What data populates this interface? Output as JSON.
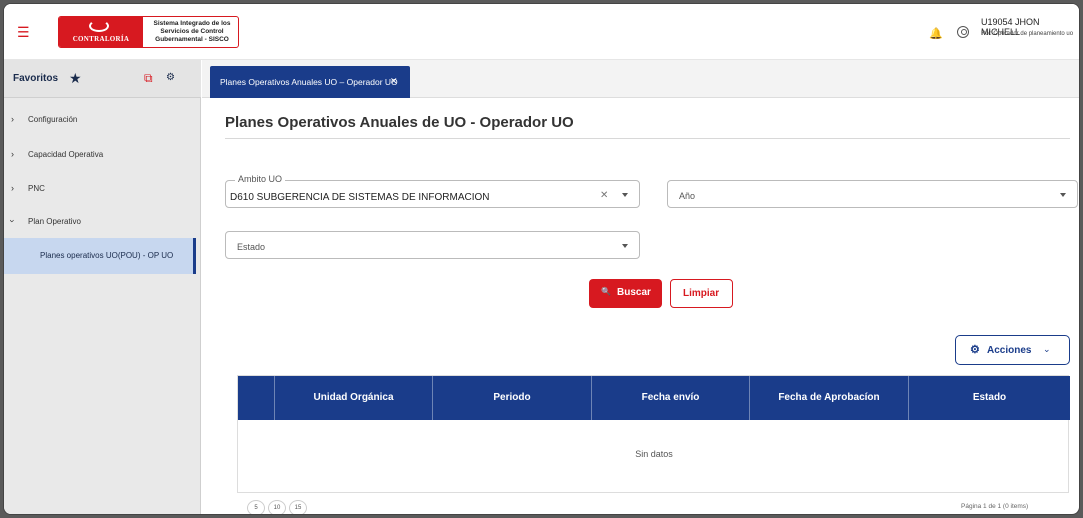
{
  "header": {
    "menu_icon": "hamburger-icon",
    "logo": {
      "name": "CONTRALORÍA",
      "text": "Sistema Integrado de los Servicios de Control Gubernamental - SISCO"
    },
    "user": {
      "name": "U19054 JHON MICHELL",
      "role": "Rol: Operador de planeamiento uo"
    },
    "bell_icon": "bell-icon",
    "user_icon": "user-circle-icon"
  },
  "sidebar": {
    "favorites_label": "Favoritos",
    "favorites_icon": "star-icon",
    "items": [
      {
        "label": "Configuración",
        "expanded": false
      },
      {
        "label": "Capacidad Operativa",
        "expanded": false
      },
      {
        "label": "PNC",
        "expanded": false
      },
      {
        "label": "Plan Operativo",
        "expanded": true
      }
    ],
    "active_item": "Planes operativos UO(POU) - OP UO"
  },
  "tabs": [
    {
      "label": "Planes Operativos Anuales UO – Operador UO",
      "active": true
    }
  ],
  "main": {
    "title": "Planes Operativos Anuales de UO - Operador UO",
    "filters": {
      "ambito": {
        "label": "Ambito UO",
        "value": "D610 SUBGERENCIA DE SISTEMAS DE INFORMACION"
      },
      "anio": {
        "placeholder": "Año"
      },
      "estado": {
        "placeholder": "Estado"
      }
    },
    "buttons": {
      "buscar": "Buscar",
      "limpiar": "Limpiar",
      "acciones": "Acciones"
    }
  },
  "table": {
    "columns": [
      "Unidad Orgánica",
      "Periodo",
      "Fecha envío",
      "Fecha de Aprobacíon",
      "Estado"
    ],
    "rows": [],
    "empty_text": "Sin datos",
    "page_sizes": [
      "5",
      "10",
      "15"
    ],
    "pagination_info": "Página 1 de 1 (0 items)"
  },
  "colors": {
    "brand_red": "#d71920",
    "primary_blue": "#1a3c8a",
    "active_item_bg": "#c7d7ef"
  }
}
